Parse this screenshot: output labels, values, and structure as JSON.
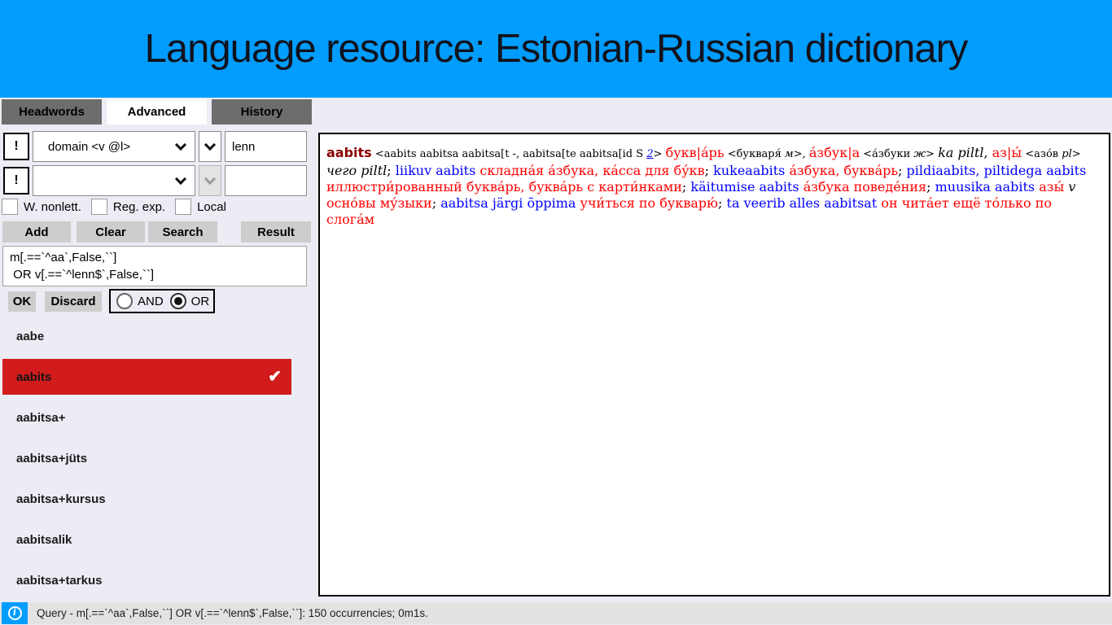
{
  "header": {
    "title": "Language resource: Estonian-Russian dictionary"
  },
  "tabs": [
    {
      "label": "Headwords",
      "active": false
    },
    {
      "label": "Advanced",
      "active": true
    },
    {
      "label": "History",
      "active": false
    }
  ],
  "search_form": {
    "negate_label": "!",
    "row1": {
      "field": "domain <v @l>",
      "value": "lenn"
    },
    "row2": {
      "field": "",
      "value": ""
    },
    "checkboxes": [
      {
        "label": "W. nonlett.",
        "checked": false
      },
      {
        "label": "Reg. exp.",
        "checked": false
      },
      {
        "label": "Local",
        "checked": false
      }
    ],
    "buttons": {
      "add": "Add",
      "clear": "Clear",
      "search": "Search",
      "result": "Result"
    },
    "query_text": "m[.==`^aa`,False,``]\n OR v[.==`^lenn$`,False,``]",
    "ok_label": "OK",
    "discard_label": "Discard",
    "radio": {
      "and": "AND",
      "or": "OR",
      "selected": "OR"
    }
  },
  "wordlist": {
    "items": [
      {
        "label": "aabe",
        "selected": false
      },
      {
        "label": "aabits",
        "selected": true
      },
      {
        "label": "aabitsa+",
        "selected": false
      },
      {
        "label": "aabitsa+jüts",
        "selected": false
      },
      {
        "label": "aabitsa+kursus",
        "selected": false
      },
      {
        "label": "aabitsalik",
        "selected": false
      },
      {
        "label": "aabitsa+tarkus",
        "selected": false
      }
    ]
  },
  "entry": {
    "headword": "aabits",
    "runs": [
      {
        "t": "aabits",
        "s": "headword"
      },
      {
        "t": " <aabits aabitsa aabitsa[t -, aabitsa[te aabitsa[id S ",
        "s": "gram"
      },
      {
        "t": "2",
        "s": "link"
      },
      {
        "t": "> ",
        "s": "gram"
      },
      {
        "t": "букв|а́рь",
        "s": "ru"
      },
      {
        "t": " <букваря́ ",
        "s": "gram"
      },
      {
        "t": "м",
        "s": "gram-i"
      },
      {
        "t": ">, ",
        "s": "gram"
      },
      {
        "t": "а́збук|а",
        "s": "ru"
      },
      {
        "t": " <а́збуки ",
        "s": "gram"
      },
      {
        "t": "ж",
        "s": "gram-i"
      },
      {
        "t": "> ",
        "s": "gram"
      },
      {
        "t": "ka piltl",
        "s": "label"
      },
      {
        "t": ", ",
        "s": "plain"
      },
      {
        "t": "аз|ы́",
        "s": "ru"
      },
      {
        "t": " <азо́в ",
        "s": "gram"
      },
      {
        "t": "pl",
        "s": "gram-i"
      },
      {
        "t": "> ",
        "s": "gram"
      },
      {
        "t": "чего piltl",
        "s": "label"
      },
      {
        "t": "; ",
        "s": "plain"
      },
      {
        "t": "liikuv aabits",
        "s": "et"
      },
      {
        "t": " ",
        "s": "plain"
      },
      {
        "t": "складна́я а́збука, ка́сса для бу́кв",
        "s": "ru"
      },
      {
        "t": "; ",
        "s": "plain"
      },
      {
        "t": "kukeaabits",
        "s": "et"
      },
      {
        "t": " ",
        "s": "plain"
      },
      {
        "t": "а́збука, буква́рь",
        "s": "ru"
      },
      {
        "t": "; ",
        "s": "plain"
      },
      {
        "t": "pildiaabits, piltidega aabits",
        "s": "et"
      },
      {
        "t": " ",
        "s": "plain"
      },
      {
        "t": "иллюстри́рованный буква́рь, буква́рь с карти́нками",
        "s": "ru"
      },
      {
        "t": "; ",
        "s": "plain"
      },
      {
        "t": "käitumise aabits",
        "s": "et"
      },
      {
        "t": " ",
        "s": "plain"
      },
      {
        "t": "а́збука поведе́ния",
        "s": "ru"
      },
      {
        "t": "; ",
        "s": "plain"
      },
      {
        "t": "muusika aabits",
        "s": "et"
      },
      {
        "t": " ",
        "s": "plain"
      },
      {
        "t": "азы́",
        "s": "ru"
      },
      {
        "t": " v ",
        "s": "label"
      },
      {
        "t": "осно́вы му́зыки",
        "s": "ru"
      },
      {
        "t": "; ",
        "s": "plain"
      },
      {
        "t": "aabitsa järgi õppima",
        "s": "et"
      },
      {
        "t": " ",
        "s": "plain"
      },
      {
        "t": "учи́ться по букварю́",
        "s": "ru"
      },
      {
        "t": "; ",
        "s": "plain"
      },
      {
        "t": "ta veerib alles aabitsat",
        "s": "et"
      },
      {
        "t": " ",
        "s": "plain"
      },
      {
        "t": "он чита́ет ещё то́лько по слога́м",
        "s": "ru"
      }
    ]
  },
  "statusbar": {
    "icon": "info-icon",
    "text": "Query - m[.==`^aa`,False,``] OR v[.==`^lenn$`,False,``]: 150 occurrencies; 0m1s.",
    "accent_color": "#009dff"
  },
  "colors": {
    "header_blue": "#009dff",
    "selected_red": "#d21c1c",
    "russian_red": "#ff0000",
    "estonian_blue": "#0000ff",
    "headword_maroon": "#8b0000"
  }
}
